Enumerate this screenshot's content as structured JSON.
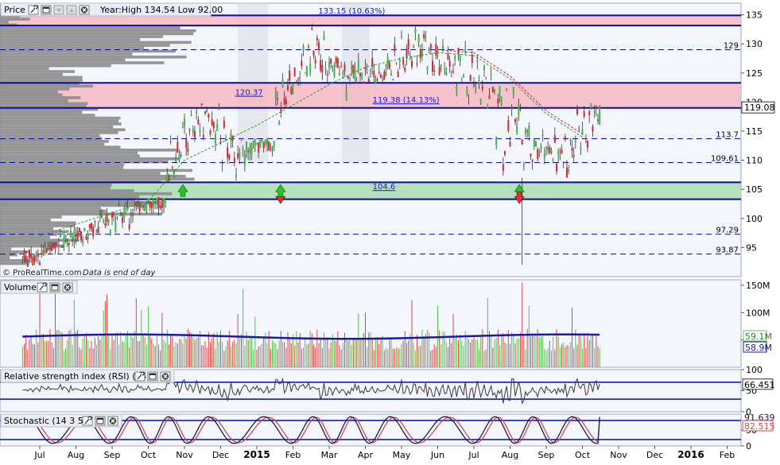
{
  "panels": {
    "price": {
      "title": "Price",
      "info": "Year:High 134.54 Low 92.00",
      "watermark_brand": "© ProRealTime.com",
      "watermark_note": "Data is end of day"
    },
    "volume": {
      "title": "Volume"
    },
    "rsi": {
      "title": "Relative strength index (RSI) (14)"
    },
    "stoch": {
      "title": "Stochastic (14 3 5)"
    }
  },
  "icons": [
    "wrench-icon",
    "window-icon",
    "down-arrow-icon",
    "up-arrow-icon",
    "close-icon"
  ],
  "chart_data": {
    "type": "candlestick",
    "x_labels": [
      "Jul",
      "Aug",
      "Sep",
      "Oct",
      "Nov",
      "Dec",
      "2015",
      "Feb",
      "Mar",
      "Apr",
      "May",
      "Jun",
      "Jul",
      "Aug",
      "Sep",
      "Oct",
      "Nov",
      "Dec",
      "2016",
      "Feb"
    ],
    "price": {
      "ylim": [
        90,
        137
      ],
      "y_ticks": [
        95,
        100,
        105,
        110,
        115,
        120,
        125,
        130,
        135
      ],
      "current_price": "119.08",
      "year_high": 134.54,
      "year_low": 92.0,
      "levels_solid": [
        134.9,
        133.15,
        123.3,
        119.0,
        106.2,
        103.3
      ],
      "levels_dashed": [
        {
          "value": 129,
          "label": "129"
        },
        {
          "value": 113.7,
          "label": "113.7"
        },
        {
          "value": 109.61,
          "label": "109.61"
        },
        {
          "value": 97.29,
          "label": "97.29"
        },
        {
          "value": 93.87,
          "label": "93.87"
        }
      ],
      "zones": [
        {
          "from": 133.15,
          "to": 134.9,
          "kind": "resistance"
        },
        {
          "from": 119.0,
          "to": 123.3,
          "kind": "resistance"
        },
        {
          "from": 103.3,
          "to": 106.2,
          "kind": "support"
        }
      ],
      "annotations": [
        {
          "text": "133.15 (10.63%)",
          "x": "Apr 2015",
          "y": 135.2
        },
        {
          "text": "120.37",
          "x": "Dec 2014",
          "y": 121.2
        },
        {
          "text": "119.38 (14.13%)",
          "x": "Mar 2015",
          "y": 119.9
        },
        {
          "text": "104.6",
          "x": "Mar 2015",
          "y": 105.0
        }
      ],
      "signals": [
        {
          "type": "up",
          "x": "Oct 2014",
          "y": 104.6
        },
        {
          "type": "down",
          "x": "Jan 2015",
          "y": 104.6
        },
        {
          "type": "up",
          "x": "Jan 2015",
          "y": 104.6
        },
        {
          "type": "up",
          "x": "Aug 2015",
          "y": 104.6
        },
        {
          "type": "down",
          "x": "Aug 2015",
          "y": 104.6
        }
      ],
      "ohlc_monthly": [
        {
          "month": "Jul 2014",
          "open": 92.5,
          "high": 96.0,
          "low": 92.0,
          "close": 95.6
        },
        {
          "month": "Aug 2014",
          "open": 95.6,
          "high": 99.0,
          "low": 94.0,
          "close": 98.5
        },
        {
          "month": "Sep 2014",
          "open": 98.5,
          "high": 103.5,
          "low": 97.5,
          "close": 100.8
        },
        {
          "month": "Oct 2014",
          "open": 100.8,
          "high": 103.0,
          "low": 95.5,
          "close": 108.0
        },
        {
          "month": "Nov 2014",
          "open": 108.0,
          "high": 119.0,
          "low": 107.0,
          "close": 118.5
        },
        {
          "month": "Dec 2014",
          "open": 118.5,
          "high": 119.8,
          "low": 106.5,
          "close": 110.0
        },
        {
          "month": "Jan 2015",
          "open": 110.0,
          "high": 113.0,
          "low": 105.0,
          "close": 117.2
        },
        {
          "month": "Feb 2015",
          "open": 117.2,
          "high": 130.0,
          "low": 116.5,
          "close": 128.5
        },
        {
          "month": "Mar 2015",
          "open": 128.5,
          "high": 133.5,
          "low": 121.0,
          "close": 124.5
        },
        {
          "month": "Apr 2015",
          "open": 124.5,
          "high": 130.0,
          "low": 123.5,
          "close": 125.2
        },
        {
          "month": "May 2015",
          "open": 125.2,
          "high": 134.5,
          "low": 124.5,
          "close": 130.3
        },
        {
          "month": "Jun 2015",
          "open": 130.3,
          "high": 133.5,
          "low": 124.5,
          "close": 125.4
        },
        {
          "month": "Jul 2015",
          "open": 125.4,
          "high": 133.0,
          "low": 119.5,
          "close": 121.3
        },
        {
          "month": "Aug 2015",
          "open": 121.3,
          "high": 122.0,
          "low": 92.0,
          "close": 112.8
        },
        {
          "month": "Sep 2015",
          "open": 112.8,
          "high": 116.5,
          "low": 107.5,
          "close": 110.5
        },
        {
          "month": "Oct 2015",
          "open": 110.5,
          "high": 119.5,
          "low": 107.0,
          "close": 119.08
        }
      ],
      "moving_average": [
        [
          0,
          97
        ],
        [
          1,
          99
        ],
        [
          2,
          101
        ],
        [
          3,
          103
        ],
        [
          4,
          110
        ],
        [
          5,
          113
        ],
        [
          6,
          116
        ],
        [
          7,
          119.5
        ],
        [
          8,
          123
        ],
        [
          9,
          126
        ],
        [
          10,
          127.5
        ],
        [
          11,
          128.5
        ],
        [
          12,
          128
        ],
        [
          13,
          124
        ],
        [
          14,
          118
        ],
        [
          15,
          114
        ]
      ]
    },
    "volume": {
      "y_ticks": [
        "50M",
        "100M",
        "150M"
      ],
      "current_labels": [
        "59.1M",
        "58.9M"
      ],
      "ylim": [
        0,
        160
      ]
    },
    "rsi": {
      "y_ticks": [
        0,
        50,
        100
      ],
      "current": "66.451",
      "ylim": [
        0,
        100
      ]
    },
    "stoch": {
      "y_ticks": [
        0,
        50
      ],
      "current": "82.515",
      "current_hidden": "91.639",
      "ylim": [
        0,
        100
      ]
    }
  }
}
